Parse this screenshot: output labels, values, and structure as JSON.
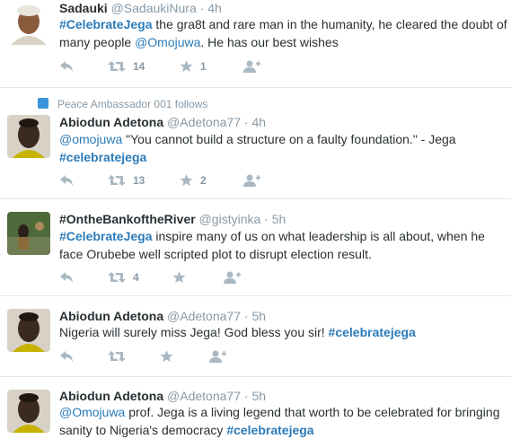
{
  "tweets": [
    {
      "name": "Sadauki",
      "handle": "@SadaukiNura",
      "time": "4h",
      "segments": [
        {
          "text": "#CelebrateJega",
          "type": "hashtag"
        },
        {
          "text": "  the gra8t and rare man in the humanity, he cleared the doubt of many people ",
          "type": "text"
        },
        {
          "text": "@Omojuwa",
          "type": "mention"
        },
        {
          "text": ". He has our best wishes",
          "type": "text"
        }
      ],
      "retweet_count": "14",
      "favorite_count": "1"
    },
    {
      "context": "Peace Ambassador 001 follows",
      "name": "Abiodun Adetona",
      "handle": "@Adetona77",
      "time": "4h",
      "segments": [
        {
          "text": "@omojuwa",
          "type": "mention"
        },
        {
          "text": " \"You cannot build a structure on a faulty foundation.\" - Jega ",
          "type": "text"
        },
        {
          "text": "#celebratejega",
          "type": "hashtag"
        }
      ],
      "retweet_count": "13",
      "favorite_count": "2"
    },
    {
      "name": "#OntheBankoftheRiver",
      "handle": "@gistyinka",
      "time": "5h",
      "segments": [
        {
          "text": "#CelebrateJega",
          "type": "hashtag"
        },
        {
          "text": " inspire many of us on what leadership is all about, when he face Orubebe well scripted plot to disrupt election result.",
          "type": "text"
        }
      ],
      "retweet_count": "4",
      "favorite_count": ""
    },
    {
      "name": "Abiodun Adetona",
      "handle": "@Adetona77",
      "time": "5h",
      "segments": [
        {
          "text": "Nigeria will surely miss Jega! God bless you sir! ",
          "type": "text"
        },
        {
          "text": "#celebratejega",
          "type": "hashtag"
        }
      ],
      "retweet_count": "",
      "favorite_count": ""
    },
    {
      "name": "Abiodun Adetona",
      "handle": "@Adetona77",
      "time": "5h",
      "segments": [
        {
          "text": "@Omojuwa",
          "type": "mention"
        },
        {
          "text": " prof. Jega is a living legend that worth to be celebrated for bringing sanity to Nigeria's democracy ",
          "type": "text"
        },
        {
          "text": "#celebratejega",
          "type": "hashtag"
        }
      ],
      "retweet_count": "",
      "favorite_count": ""
    }
  ],
  "icons": [
    "reply-icon",
    "retweet-icon",
    "favorite-icon",
    "follow-icon"
  ],
  "colors": {
    "name": "#292f33",
    "meta": "#8899a6",
    "link": "#2b7bb9",
    "icon": "#aab8c2",
    "divider": "#e1e8ed"
  }
}
